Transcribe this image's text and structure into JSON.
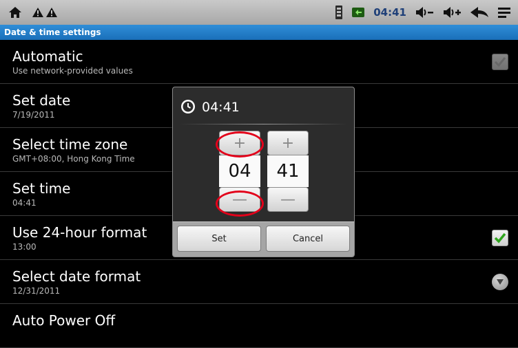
{
  "status_bar": {
    "left_icons": [
      "home-icon",
      "warning-icon",
      "warning-icon"
    ],
    "right_icons": [
      "sim-card-icon",
      "battery-icon",
      "volume-down-icon",
      "volume-up-icon",
      "back-icon",
      "menu-icon"
    ],
    "time": "04:41",
    "time_color": "#1e3f78"
  },
  "title_bar": {
    "title": "Date & time settings",
    "color": "#2582cc"
  },
  "settings": [
    {
      "title": "Automatic",
      "subtitle": "Use network-provided values",
      "control": "checkbox",
      "checked": true,
      "enabled": false
    },
    {
      "title": "Set date",
      "subtitle": "7/19/2011"
    },
    {
      "title": "Select time zone",
      "subtitle": "GMT+08:00, Hong Kong Time"
    },
    {
      "title": "Set time",
      "subtitle": "04:41"
    },
    {
      "title": "Use 24-hour format",
      "subtitle": "13:00",
      "control": "checkbox",
      "checked": true,
      "enabled": true
    },
    {
      "title": "Select date format",
      "subtitle": "12/31/2011",
      "control": "dropdown-icon"
    },
    {
      "title": "Auto Power Off",
      "subtitle": ""
    }
  ],
  "dialog": {
    "icon": "clock-icon",
    "title": "04:41",
    "hour": {
      "value": "04",
      "increment": "+",
      "decrement": "—"
    },
    "minute": {
      "value": "41",
      "increment": "+",
      "decrement": "—"
    },
    "set_label": "Set",
    "cancel_label": "Cancel",
    "highlight_color": "#e2001a"
  }
}
